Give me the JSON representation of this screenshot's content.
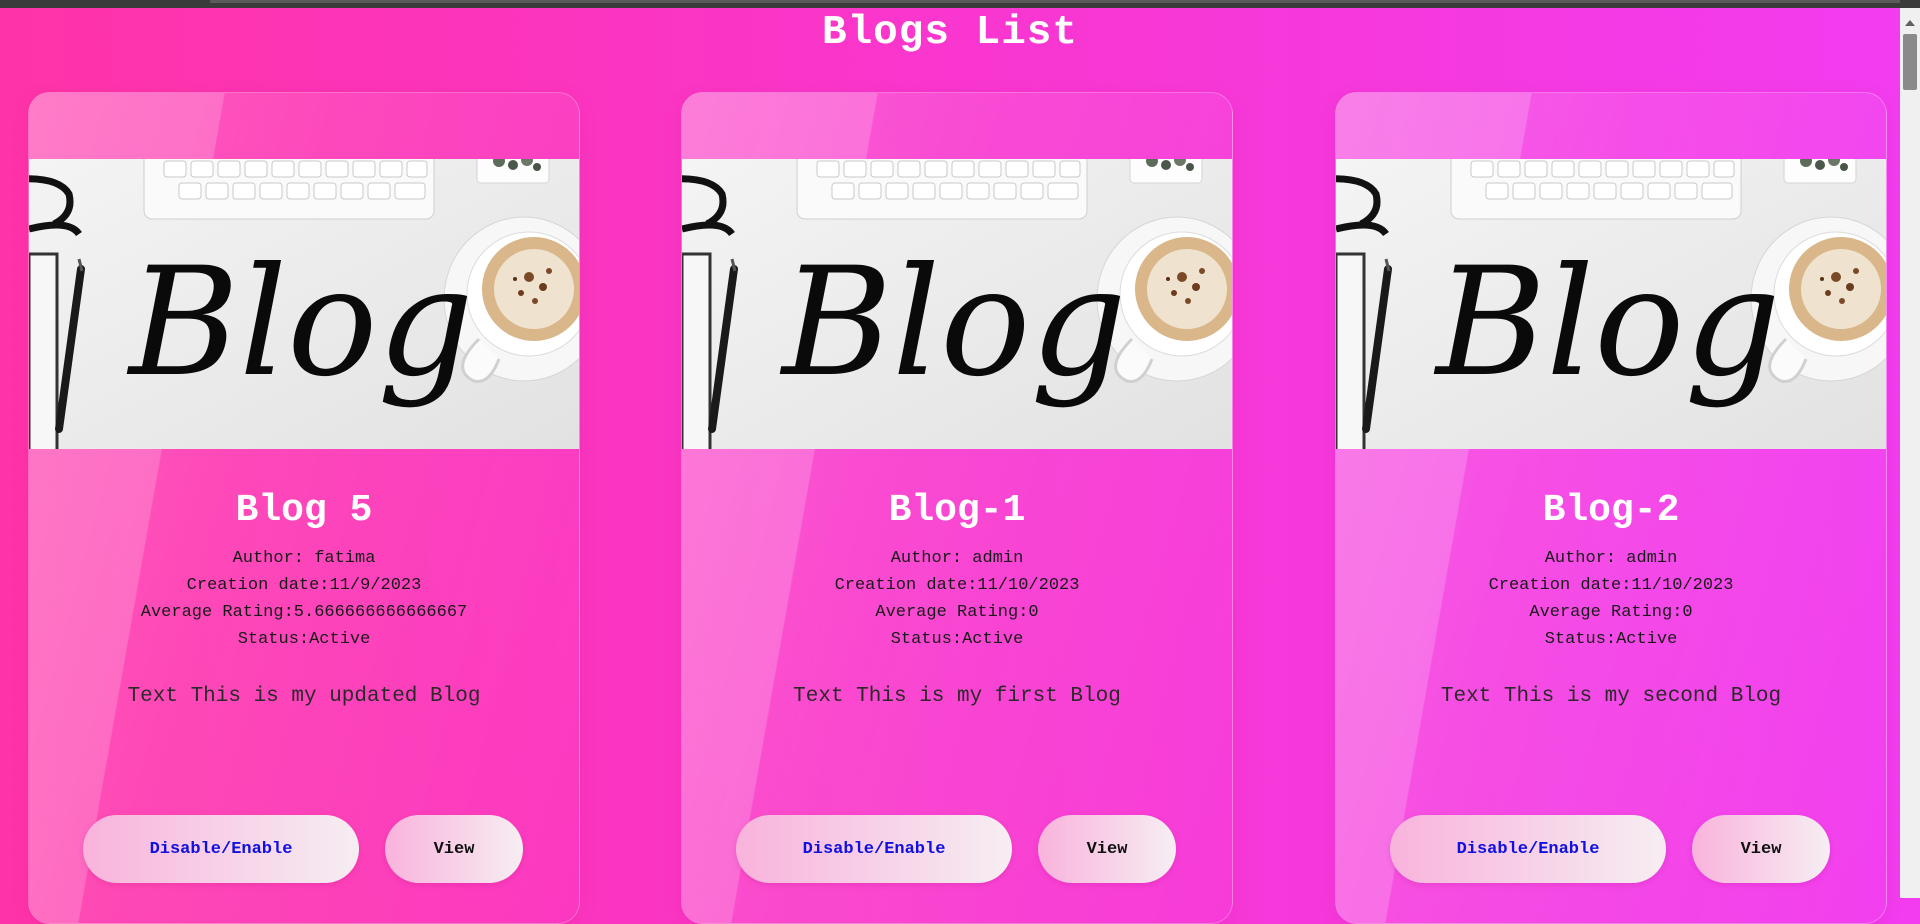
{
  "page": {
    "title": "Blogs List"
  },
  "colors": {
    "background_start": "#ff33a8",
    "background_end": "#f23cf0",
    "title": "#ffffff",
    "toggle_text": "#1010e0"
  },
  "image": {
    "logo_word": "Blog"
  },
  "blogs": [
    {
      "title": "Blog 5",
      "author": "Author: fatima",
      "creation_date": "Creation date:11/9/2023",
      "average_rating": "Average Rating:5.666666666666667",
      "status": "Status:Active",
      "text": "Text This is my updated Blog",
      "toggle_label": "Disable/Enable",
      "view_label": "View"
    },
    {
      "title": "Blog-1",
      "author": "Author: admin",
      "creation_date": "Creation date:11/10/2023",
      "average_rating": "Average Rating:0",
      "status": "Status:Active",
      "text": "Text This is my first Blog",
      "toggle_label": "Disable/Enable",
      "view_label": "View"
    },
    {
      "title": "Blog-2",
      "author": "Author: admin",
      "creation_date": "Creation date:11/10/2023",
      "average_rating": "Average Rating:0",
      "status": "Status:Active",
      "text": "Text This is my second Blog",
      "toggle_label": "Disable/Enable",
      "view_label": "View"
    }
  ]
}
